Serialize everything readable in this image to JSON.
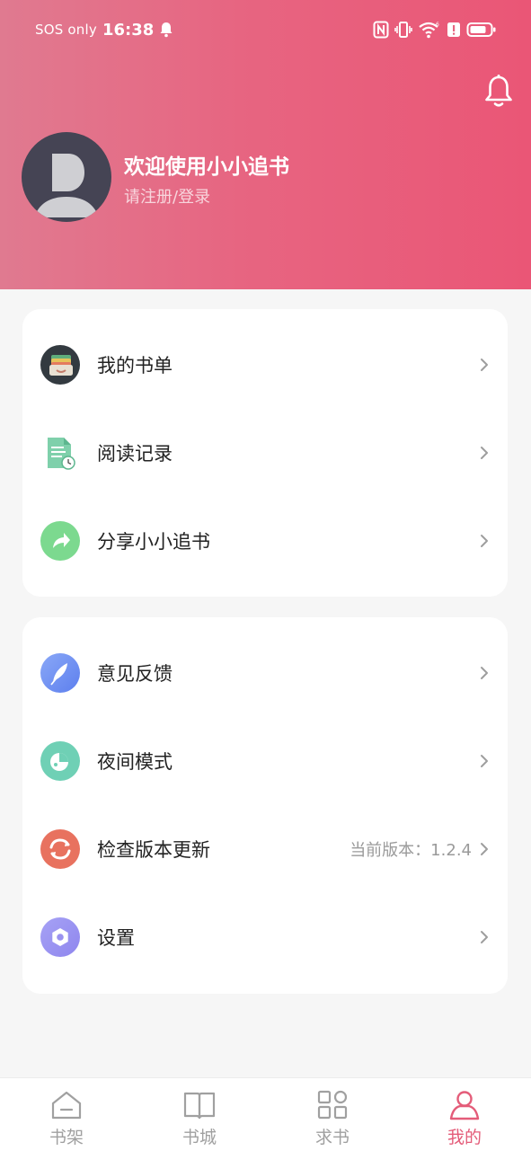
{
  "status_bar": {
    "carrier": "SOS only",
    "time": "16:38"
  },
  "profile": {
    "welcome": "欢迎使用小小追书",
    "login_prompt": "请注册/登录"
  },
  "menu_group_1": [
    {
      "label": "我的书单",
      "icon": "booklist-wallet-icon"
    },
    {
      "label": "阅读记录",
      "icon": "reading-history-icon"
    },
    {
      "label": "分享小小追书",
      "icon": "share-icon"
    }
  ],
  "menu_group_2": [
    {
      "label": "意见反馈",
      "icon": "feedback-feather-icon"
    },
    {
      "label": "夜间模式",
      "icon": "night-mode-icon"
    },
    {
      "label": "检查版本更新",
      "icon": "update-icon",
      "value": "当前版本：1.2.4"
    },
    {
      "label": "设置",
      "icon": "settings-icon"
    }
  ],
  "tabs": [
    {
      "label": "书架",
      "icon": "bookshelf-icon",
      "active": false
    },
    {
      "label": "书城",
      "icon": "bookstore-icon",
      "active": false
    },
    {
      "label": "求书",
      "icon": "request-book-icon",
      "active": false
    },
    {
      "label": "我的",
      "icon": "profile-icon",
      "active": true
    }
  ],
  "colors": {
    "header_start": "#e07a90",
    "header_end": "#ea5676",
    "accent": "#e45c79",
    "background": "#f6f6f6"
  }
}
